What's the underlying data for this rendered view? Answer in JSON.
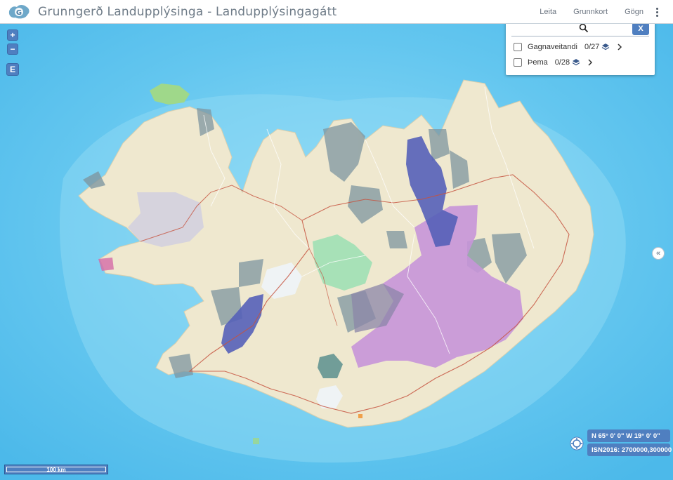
{
  "header": {
    "title": "Grunngerð Landupplýsinga - Landupplýsingagátt",
    "nav": [
      "Leita",
      "Grunnkort",
      "Gögn"
    ]
  },
  "controls": {
    "zoom_in": "+",
    "zoom_out": "−",
    "e_label": "E"
  },
  "panel": {
    "close_label": "X",
    "layers": [
      {
        "label": "Gagnaveitandi",
        "count": "0/27",
        "checked": false
      },
      {
        "label": "Þema",
        "count": "0/28",
        "checked": false
      }
    ]
  },
  "side_toggle": "«",
  "coordinates": {
    "geographic": "N 65° 0' 0\" W 19° 0' 0\"",
    "projected": "ISN2016: 2700000,300000"
  },
  "scale": {
    "label": "100 km"
  },
  "colors": {
    "accent": "#4f7fc0",
    "sea": "#5ec5ee",
    "land": "#efe7cf",
    "purple_region": "#5560b8",
    "pink_region": "#c88ed6"
  },
  "icons": {
    "logo": "iceland-logo-icon",
    "search": "search-icon",
    "layers": "layers-stack-icon",
    "locate": "crosshair-icon"
  }
}
